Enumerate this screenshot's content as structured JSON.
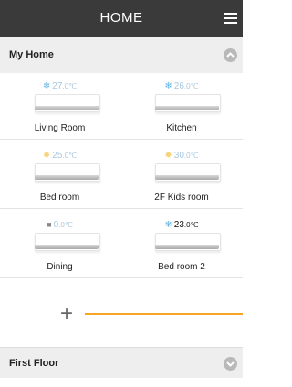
{
  "header": {
    "title": "HOME",
    "menu_icon": "hamburger-menu-icon"
  },
  "sections": [
    {
      "label": "My Home",
      "icon": "chevron-up-icon"
    },
    {
      "label": "First Floor",
      "icon": "chevron-down-icon"
    }
  ],
  "rooms": [
    {
      "name": "Living Room",
      "temp": "27",
      "unit": ".0℃",
      "mode": "cool"
    },
    {
      "name": "Kitchen",
      "temp": "26",
      "unit": ".0℃",
      "mode": "cool"
    },
    {
      "name": "Bed room",
      "temp": "25",
      "unit": ".0℃",
      "mode": "sun"
    },
    {
      "name": "2F Kids room",
      "temp": "30",
      "unit": ".0℃",
      "mode": "sun"
    },
    {
      "name": "Dining",
      "temp": "0",
      "unit": ".0℃",
      "mode": "off"
    },
    {
      "name": "Bed room 2",
      "temp": "23",
      "unit": ".0℃",
      "mode": "cool-active"
    }
  ],
  "add": {
    "label": "+"
  },
  "colors": {
    "header": "#3a3a3a",
    "section": "#eeeeee",
    "accent_line": "#f6a623",
    "cool": "#5fb2e6"
  }
}
